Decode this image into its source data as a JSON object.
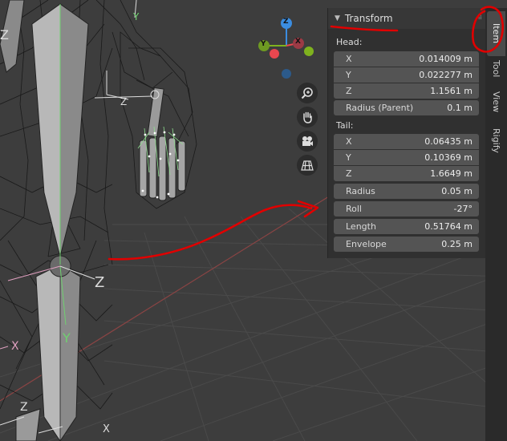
{
  "viewport": {
    "gizmo_axes": {
      "z": "Z",
      "x": "X",
      "y": "Y"
    },
    "bone_axis_labels": {
      "z": "Z",
      "y": "Y",
      "x": "X"
    },
    "buttons": [
      {
        "name": "zoom-icon"
      },
      {
        "name": "pan-hand-icon"
      },
      {
        "name": "camera-icon"
      },
      {
        "name": "perspective-grid-icon"
      }
    ]
  },
  "panel": {
    "title": "Transform",
    "head_label": "Head:",
    "head": [
      {
        "label": "X",
        "value": "0.014009 m"
      },
      {
        "label": "Y",
        "value": "0.022277 m"
      },
      {
        "label": "Z",
        "value": "1.1561 m"
      }
    ],
    "radius_parent": {
      "label": "Radius (Parent)",
      "value": "0.1 m"
    },
    "tail_label": "Tail:",
    "tail": [
      {
        "label": "X",
        "value": "0.06435 m"
      },
      {
        "label": "Y",
        "value": "0.10369 m"
      },
      {
        "label": "Z",
        "value": "1.6649 m"
      }
    ],
    "radius": {
      "label": "Radius",
      "value": "0.05 m"
    },
    "roll": {
      "label": "Roll",
      "value": "-27°"
    },
    "length": {
      "label": "Length",
      "value": "0.51764 m"
    },
    "envelope": {
      "label": "Envelope",
      "value": "0.25 m"
    }
  },
  "tabs": [
    "Item",
    "Tool",
    "View",
    "Rigify"
  ],
  "colors": {
    "viewport_bg": "#3d3d3d",
    "panel_bg": "#303030",
    "field_bg": "#545454",
    "annotation": "#e00000",
    "axis_x": "#e8474f",
    "axis_y": "#7fb21e",
    "axis_z": "#3b8de0"
  }
}
